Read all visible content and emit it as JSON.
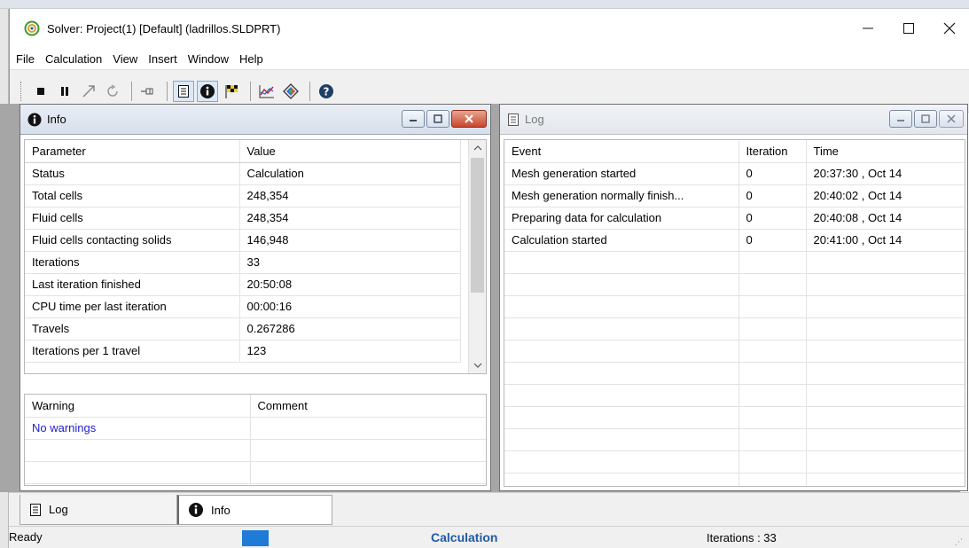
{
  "window": {
    "title": "Solver: Project(1) [Default] (ladrillos.SLDPRT)"
  },
  "menu": [
    "File",
    "Calculation",
    "View",
    "Insert",
    "Window",
    "Help"
  ],
  "toolbar": {
    "buttons": [
      "stop-icon",
      "pause-icon",
      "insert-goal-icon",
      "refresh-icon",
      "pin-icon",
      "log-icon",
      "info-icon",
      "checkered-flag-icon",
      "goal-plot-icon",
      "preview-icon",
      "help-icon"
    ]
  },
  "info": {
    "title": "Info",
    "columns": [
      "Parameter",
      "Value"
    ],
    "rows": [
      [
        "Status",
        "Calculation"
      ],
      [
        "Total cells",
        "248,354"
      ],
      [
        "Fluid cells",
        "248,354"
      ],
      [
        "Fluid cells contacting solids",
        "146,948"
      ],
      [
        "Iterations",
        "33"
      ],
      [
        "Last iteration finished",
        "20:50:08"
      ],
      [
        "CPU time per last iteration",
        "00:00:16"
      ],
      [
        "Travels",
        "0.267286"
      ],
      [
        "Iterations per 1 travel",
        "123"
      ]
    ],
    "warnings": {
      "columns": [
        "Warning",
        "Comment"
      ],
      "rows": [
        [
          "No warnings",
          ""
        ]
      ]
    }
  },
  "log": {
    "title": "Log",
    "columns": [
      "Event",
      "Iteration",
      "Time"
    ],
    "rows": [
      [
        "Mesh generation started",
        "0",
        "20:37:30 , Oct 14"
      ],
      [
        "Mesh generation normally finish...",
        "0",
        "20:40:02 , Oct 14"
      ],
      [
        "Preparing data for calculation",
        "0",
        "20:40:08 , Oct 14"
      ],
      [
        "Calculation started",
        "0",
        "20:41:00 , Oct 14"
      ]
    ]
  },
  "tabs": {
    "log": "Log",
    "info": "Info"
  },
  "status": {
    "ready": "Ready",
    "calc": "Calculation",
    "iterations": "Iterations : 33"
  },
  "colors": {
    "accent": "#1e7bd6",
    "warning_text": "#2020d0"
  }
}
